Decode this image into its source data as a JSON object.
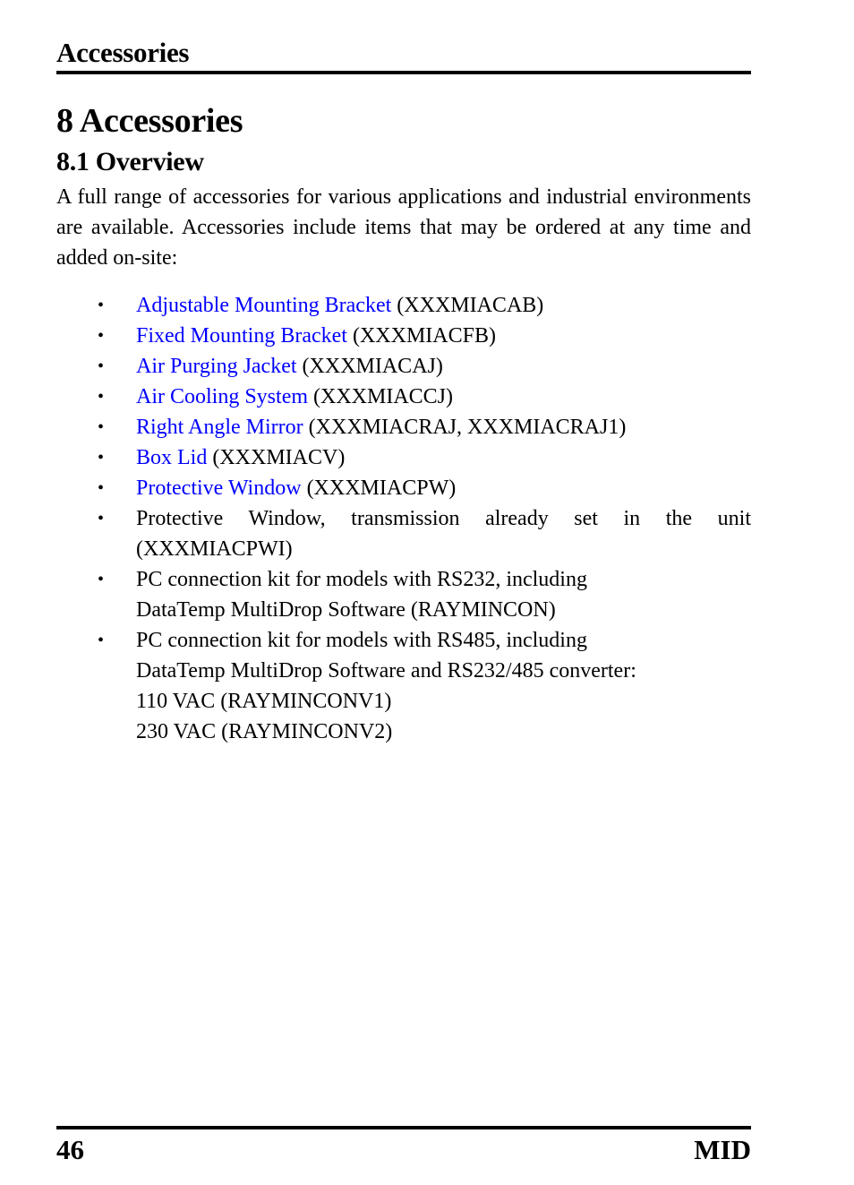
{
  "header": {
    "running_title": "Accessories"
  },
  "chapter": {
    "title": "8 Accessories"
  },
  "section": {
    "title": "8.1 Overview",
    "intro": "A full range of accessories for various applications and industrial environments are available. Accessories include items that may be ordered at any time and added on-site:"
  },
  "accessories": [
    {
      "link": "Adjustable Mounting Bracket",
      "code": " (XXXMIACAB)"
    },
    {
      "link": "Fixed Mounting Bracket",
      "code": " (XXXMIACFB)"
    },
    {
      "link": "Air Purging Jacket",
      "code": " (XXXMIACAJ)"
    },
    {
      "link": "Air Cooling System",
      "code": " (XXXMIACCJ)"
    },
    {
      "link": "Right Angle Mirror",
      "code": " (XXXMIACRAJ, XXXMIACRAJ1)"
    },
    {
      "link": "Box Lid",
      "code": " (XXXMIACV)"
    },
    {
      "link": "Protective Window",
      "code": " (XXXMIACPW)"
    }
  ],
  "other_items": [
    {
      "lines": [
        "Protective Window, transmission already set in the unit (XXXMIACPWI)"
      ]
    },
    {
      "lines": [
        "PC connection kit for models with RS232, including",
        "DataTemp MultiDrop Software (RAYMINCON)"
      ]
    },
    {
      "lines": [
        "PC connection kit for models with RS485, including",
        "DataTemp MultiDrop Software and RS232/485 converter:",
        "110 VAC (RAYMINCONV1)",
        "230 VAC (RAYMINCONV2)"
      ]
    }
  ],
  "bullet_glyph": "•",
  "colors": {
    "link": "#0000ff",
    "text": "#000000"
  },
  "footer": {
    "page_number": "46",
    "product": "MID"
  }
}
